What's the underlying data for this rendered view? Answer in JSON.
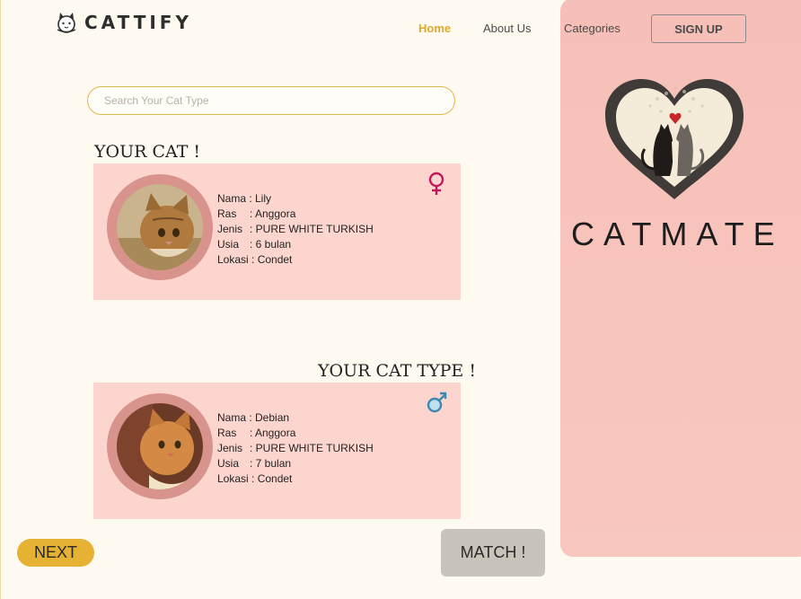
{
  "header": {
    "brand": "CATTIFY",
    "nav": {
      "home": "Home",
      "about": "About Us",
      "categories": "Categories"
    },
    "signup": "SIGN UP"
  },
  "search": {
    "placeholder": "Search Your Cat Type"
  },
  "sections": {
    "your_cat": "YOUR CAT !",
    "your_cat_type": "YOUR CAT TYPE !"
  },
  "cards": [
    {
      "gender": "female",
      "labels": [
        "Nama :",
        "Ras",
        ": Anggora"
      ],
      "nama": "Nama : Lily",
      "ras_label": "Ras",
      "ras_value": ": Anggora",
      "jenis_label": "Jenis",
      "jenis_value": ": PURE WHITE TURKISH",
      "usia_label": "Usia",
      "usia_value": ": 6 bulan",
      "lokasi": "Lokasi : Condet"
    },
    {
      "gender": "male",
      "nama": "Nama : Debian",
      "ras_label": "Ras",
      "ras_value": ": Anggora",
      "jenis_label": "Jenis",
      "jenis_value": ": PURE WHITE TURKISH",
      "usia_label": "Usia",
      "usia_value": ": 7 bulan",
      "lokasi": "Lokasi : Condet"
    }
  ],
  "right_panel": {
    "title": "CATMATE"
  },
  "buttons": {
    "next": "NEXT",
    "match": "MATCH !"
  },
  "colors": {
    "accent": "#e0a82a",
    "panel": "#f6c0b8",
    "card": "#fdd5cf",
    "female": "#c2185b",
    "male": "#3b88b0"
  },
  "icons": {
    "logo": "cat-face-icon",
    "female": "female-symbol-icon",
    "male": "male-symbol-icon",
    "heart": "heart-cats-icon"
  }
}
